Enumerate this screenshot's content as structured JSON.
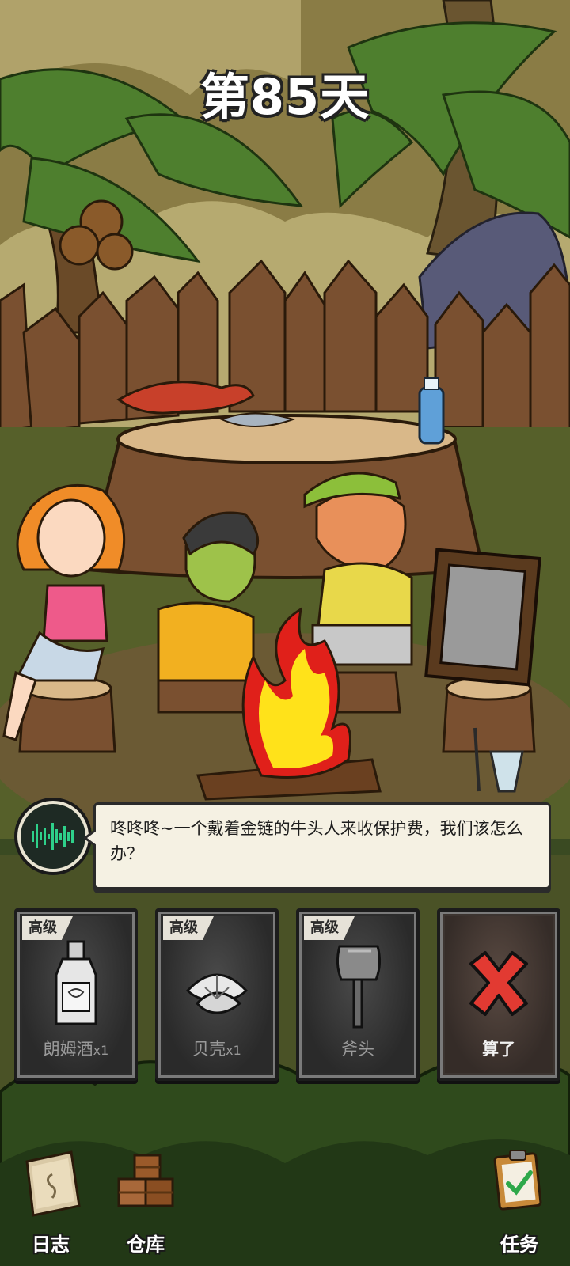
{
  "header": {
    "day_title": "第85天"
  },
  "dialog": {
    "text": "咚咚咚~一个戴着金链的牛头人来收保护费，我们该怎么办？"
  },
  "options": [
    {
      "badge": "高级",
      "label": "朗姆酒",
      "qty": "x1",
      "icon": "rum-bottle-icon"
    },
    {
      "badge": "高级",
      "label": "贝壳",
      "qty": "x1",
      "icon": "shell-icon"
    },
    {
      "badge": "高级",
      "label": "斧头",
      "qty": "",
      "icon": "axe-icon"
    },
    {
      "label": "算了",
      "icon": "cancel-x-icon"
    }
  ],
  "bottom_nav": [
    {
      "label": "日志",
      "icon": "journal-icon"
    },
    {
      "label": "仓库",
      "icon": "crates-icon"
    },
    {
      "label": "任务",
      "icon": "clipboard-check-icon"
    }
  ],
  "colors": {
    "cancel_x": "#e23a32",
    "fire": "#ffe21a",
    "fire_outline": "#e0201a"
  }
}
